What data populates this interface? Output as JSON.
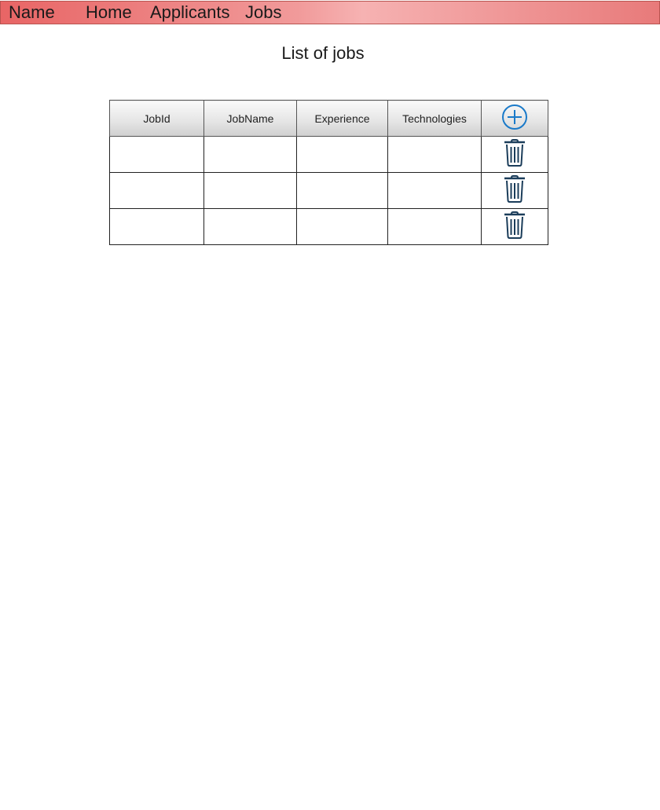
{
  "navbar": {
    "brand": "Name",
    "links": [
      "Home",
      "Applicants",
      "Jobs"
    ],
    "colors": {
      "background": "#ea6b6b",
      "border": "#b85450"
    }
  },
  "page": {
    "title": "List of jobs"
  },
  "table": {
    "columns": [
      "JobId",
      "JobName",
      "Experience",
      "Technologies"
    ],
    "add_icon": "plus-circle-icon",
    "delete_icon": "trash-icon",
    "rows": [
      {
        "JobId": "",
        "JobName": "",
        "Experience": "",
        "Technologies": ""
      },
      {
        "JobId": "",
        "JobName": "",
        "Experience": "",
        "Technologies": ""
      },
      {
        "JobId": "",
        "JobName": "",
        "Experience": "",
        "Technologies": ""
      }
    ],
    "colors": {
      "add_icon": "#1a7ac9",
      "delete_icon": "#1b3d5a"
    }
  }
}
